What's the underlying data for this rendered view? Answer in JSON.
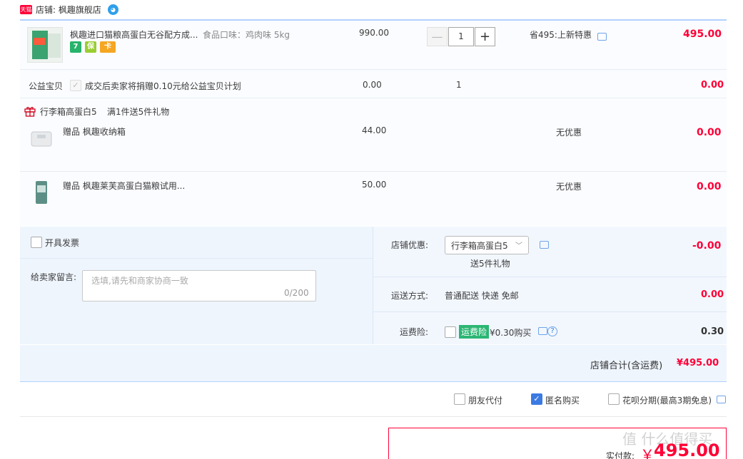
{
  "shop": {
    "logo_text": "天猫",
    "label": "店铺: 枫趣旗舰店",
    "ww_icon": "wangwang-icon"
  },
  "item": {
    "title": "枫趣进口猫粮高蛋白无谷配方成...",
    "spec": "食品口味：鸡肉味 5kg",
    "badges": [
      "7",
      "保",
      "卡"
    ],
    "price": "990.00",
    "qty": "1",
    "minus": "—",
    "plus": "+",
    "promo": "省495:上新特惠",
    "subtotal": "495.00"
  },
  "charity": {
    "label": "公益宝贝",
    "text": "成交后卖家将捐赠0.10元给公益宝贝计划",
    "price": "0.00",
    "qty": "1",
    "subtotal": "0.00"
  },
  "gift_group": {
    "label": "行李箱高蛋白5",
    "rule": "满1件送5件礼物"
  },
  "gifts": [
    {
      "title": "赠品 枫趣收纳箱",
      "price": "44.00",
      "promo": "无优惠",
      "subtotal": "0.00"
    },
    {
      "title": "赠品 枫趣莱芙高蛋白猫粮试用...",
      "price": "50.00",
      "promo": "无优惠",
      "subtotal": "0.00"
    }
  ],
  "invoice": {
    "label": "开具发票"
  },
  "message": {
    "label": "给卖家留言:",
    "placeholder": "选填,请先和商家协商一致",
    "count": "0/200"
  },
  "discount": {
    "label": "店铺优惠:",
    "selected": "行李箱高蛋白5",
    "sub": "送5件礼物",
    "value": "-0.00"
  },
  "shipping": {
    "label": "运送方式:",
    "value": "普通配送 快递 免邮",
    "price": "0.00"
  },
  "insurance": {
    "label": "运费险:",
    "tag": "运费险",
    "price": "¥0.30购买",
    "total": "0.30",
    "help": "?"
  },
  "shop_total": {
    "label": "店铺合计(含运费)",
    "value": "¥495.00"
  },
  "options": [
    {
      "label": "朋友代付",
      "checked": false
    },
    {
      "label": "匿名购买",
      "checked": true
    },
    {
      "label": "花呗分期(最高3期免息)",
      "checked": false
    }
  ],
  "payment": {
    "label": "实付款:",
    "yen": "￥",
    "value": "495.00"
  },
  "watermark": "值 什么值得买",
  "colors": {
    "accent_red": "#ff0036",
    "border_blue": "#b2d1ff",
    "panel_blue": "#eef5fd"
  }
}
